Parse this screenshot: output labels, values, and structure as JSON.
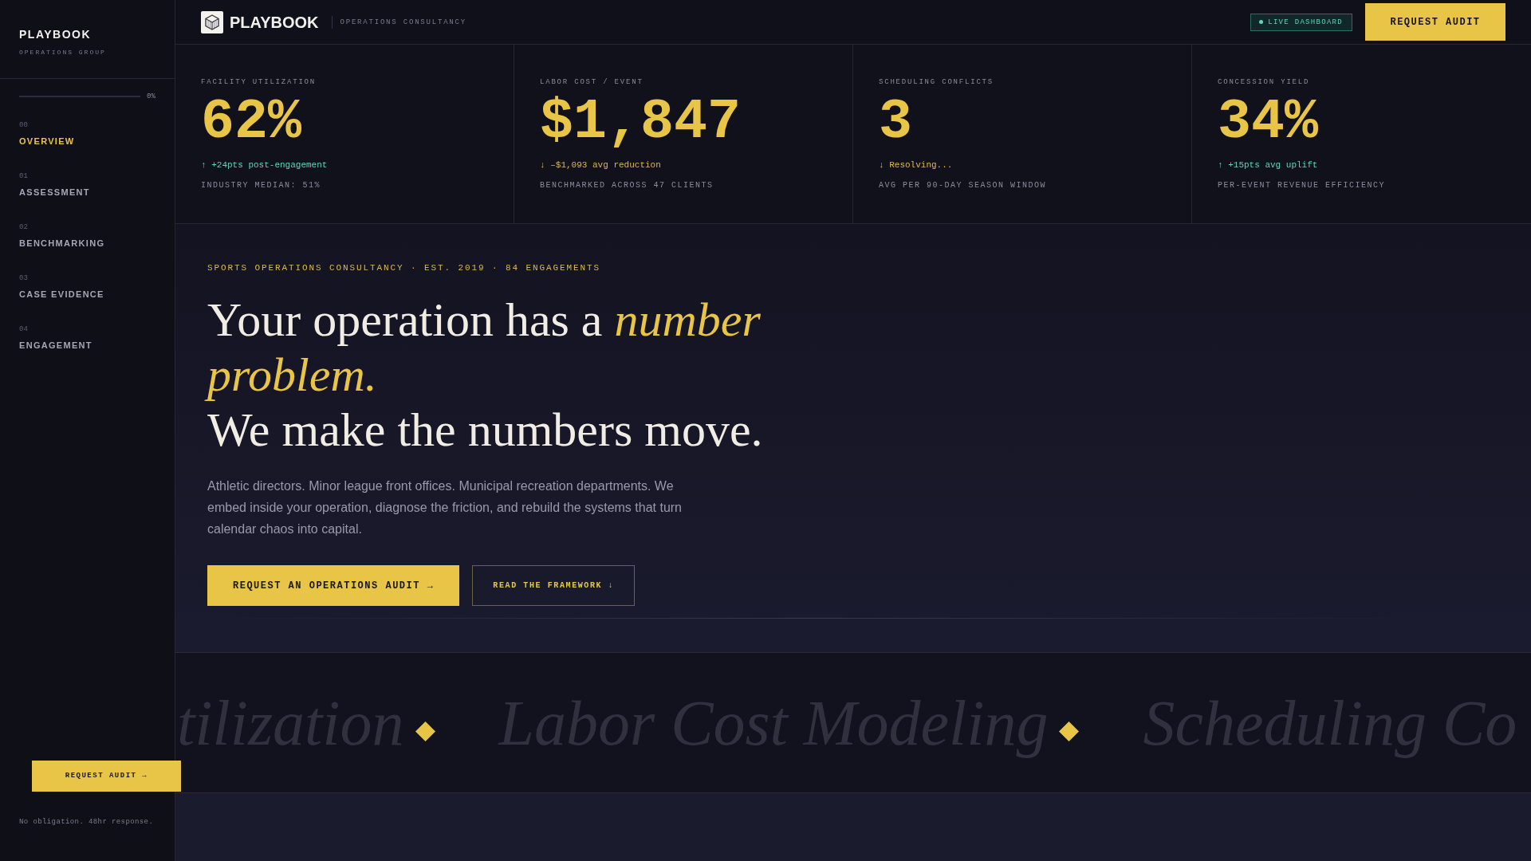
{
  "sidebar": {
    "brand": "PLAYBOOK",
    "subtitle": "OPERATIONS GROUP",
    "progress": {
      "level": 0,
      "reading": "0%"
    },
    "nav": [
      {
        "number": "00",
        "label": "OVERVIEW",
        "selected": true
      },
      {
        "number": "01",
        "label": "ASSESSMENT",
        "selected": false
      },
      {
        "number": "02",
        "label": "BENCHMARKING",
        "selected": false
      },
      {
        "number": "03",
        "label": "CASE EVIDENCE",
        "selected": false
      },
      {
        "number": "04",
        "label": "ENGAGEMENT",
        "selected": false
      }
    ],
    "cta": "REQUEST AUDIT →",
    "note": "No obligation. 48hr response."
  },
  "header": {
    "brand": "PLAYBOOK",
    "tagline": "OPERATIONS CONSULTANCY",
    "badge": "LIVE DASHBOARD",
    "button": "REQUEST AUDIT"
  },
  "stats": [
    {
      "label": "FACILITY UTILIZATION",
      "value": "62%",
      "delta": "↑ +24pts post-engagement",
      "kind": "up",
      "note": "INDUSTRY MEDIAN: 51%"
    },
    {
      "label": "LABOR COST / EVENT",
      "value": "$1,847",
      "delta": "↓ –$1,093 avg reduction",
      "kind": "down",
      "note": "BENCHMARKED ACROSS 47 CLIENTS"
    },
    {
      "label": "SCHEDULING CONFLICTS",
      "value": "3",
      "delta": "↓ Resolving...",
      "kind": "down",
      "note": "AVG PER 90-DAY SEASON WINDOW"
    },
    {
      "label": "CONCESSION YIELD",
      "value": "34%",
      "delta": "↑ +15pts avg uplift",
      "kind": "up",
      "note": "PER-EVENT REVENUE EFFICIENCY"
    }
  ],
  "hero": {
    "eyebrow": "SPORTS OPERATIONS CONSULTANCY · EST. 2019 · 84 ENGAGEMENTS",
    "headline": [
      "Your operation has a *number problem.*",
      "We make the numbers move."
    ],
    "body": "Athletic directors. Minor league front offices. Municipal recreation departments. We embed inside your operation, diagnose the friction, and rebuild the systems that turn calendar chaos into capital.",
    "buttons": [
      {
        "label": "REQUEST AN OPERATIONS AUDIT →",
        "kind": "primary"
      },
      {
        "label": "READ THE FRAMEWORK ↓",
        "kind": "secondary"
      }
    ]
  },
  "marquee": [
    "tilization",
    "Labor Cost Modeling",
    "Scheduling Co"
  ]
}
